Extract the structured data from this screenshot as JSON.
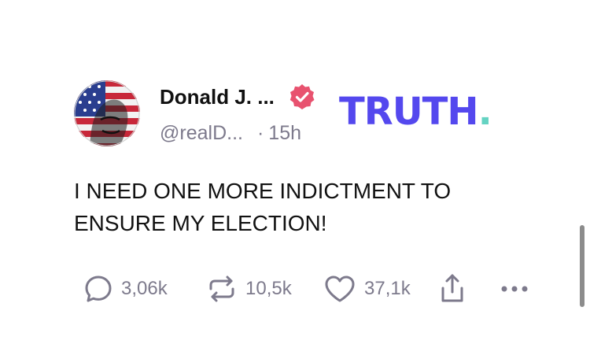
{
  "post": {
    "author": {
      "display_name": "Donald J. ...",
      "handle": "@realD...",
      "verified_icon": "verified-badge-icon",
      "avatar": "avatar"
    },
    "separator": "·",
    "timestamp": "15h",
    "text": "I NEED ONE MORE INDICTMENT TO ENSURE MY ELECTION!",
    "actions": {
      "reply": {
        "icon": "reply-icon",
        "count": "3,06k"
      },
      "retruth": {
        "icon": "retruth-icon",
        "count": "10,5k"
      },
      "like": {
        "icon": "heart-icon",
        "count": "37,1k"
      },
      "share": {
        "icon": "share-icon"
      },
      "more": {
        "icon": "more-icon"
      }
    }
  },
  "brand": {
    "logo_text": "TRUTH",
    "logo_dot": ".",
    "colors": {
      "logo": "#5448ee",
      "logo_dot": "#65d3c2",
      "verified_badge": "#e8526f",
      "muted_text": "#7d7a8c"
    }
  }
}
